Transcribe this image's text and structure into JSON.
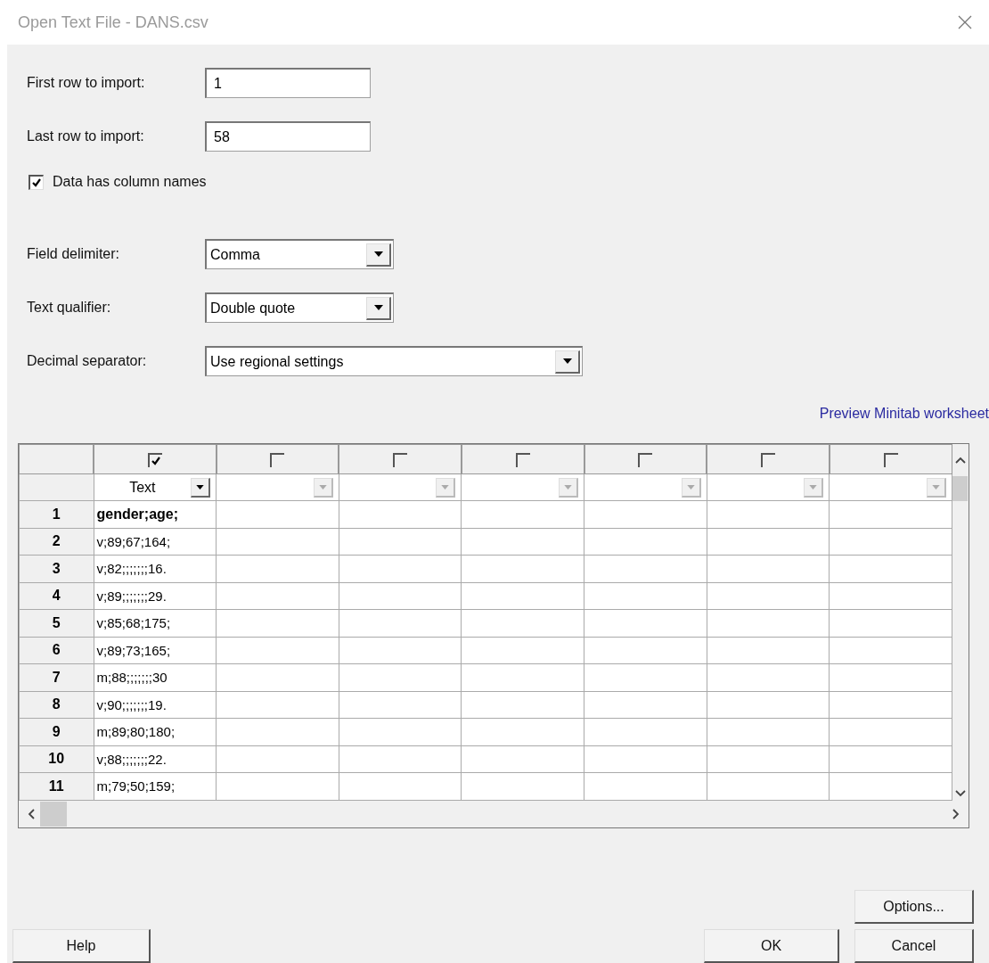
{
  "window": {
    "title": "Open Text File - DANS.csv"
  },
  "fields": [
    {
      "label": "First row to import:",
      "value": "1"
    },
    {
      "label": "Last row to import:",
      "value": "58"
    }
  ],
  "column_names_checkbox": {
    "label": "Data has column names",
    "checked": true
  },
  "dropdowns": [
    {
      "label": "Field delimiter:",
      "value": "Comma",
      "kind": "short"
    },
    {
      "label": "Text qualifier:",
      "value": "Double quote",
      "kind": "short"
    },
    {
      "label": "Decimal separator:",
      "value": "Use regional settings",
      "kind": "long"
    }
  ],
  "preview_link": {
    "label": "Preview Minitab worksheet"
  },
  "grid": {
    "columns": [
      {
        "checked": true,
        "type": "Text"
      },
      {
        "checked": false
      },
      {
        "checked": false
      },
      {
        "checked": false
      },
      {
        "checked": false
      },
      {
        "checked": false
      },
      {
        "checked": false
      }
    ],
    "rows": [
      {
        "number": "1",
        "header": true,
        "cell": "gender;age;"
      },
      {
        "number": "2",
        "header": false,
        "cell": "v;89;67;164;"
      },
      {
        "number": "3",
        "header": false,
        "cell": "v;82;;;;;;;16."
      },
      {
        "number": "4",
        "header": false,
        "cell": "v;89;;;;;;;29."
      },
      {
        "number": "5",
        "header": false,
        "cell": "v;85;68;175;"
      },
      {
        "number": "6",
        "header": false,
        "cell": "v;89;73;165;"
      },
      {
        "number": "7",
        "header": false,
        "cell": "m;88;;;;;;;30"
      },
      {
        "number": "8",
        "header": false,
        "cell": "v;90;;;;;;;19."
      },
      {
        "number": "9",
        "header": false,
        "cell": "m;89;80;180;"
      },
      {
        "number": "10",
        "header": false,
        "cell": "v;88;;;;;;;22."
      },
      {
        "number": "11",
        "header": false,
        "cell": "m;79;50;159;"
      }
    ]
  },
  "buttons": [
    {
      "label": "Options...",
      "kind": "options"
    },
    {
      "label": "Help",
      "kind": "help"
    },
    {
      "label": "OK",
      "kind": "ok"
    },
    {
      "label": "Cancel",
      "kind": "cancel"
    }
  ]
}
